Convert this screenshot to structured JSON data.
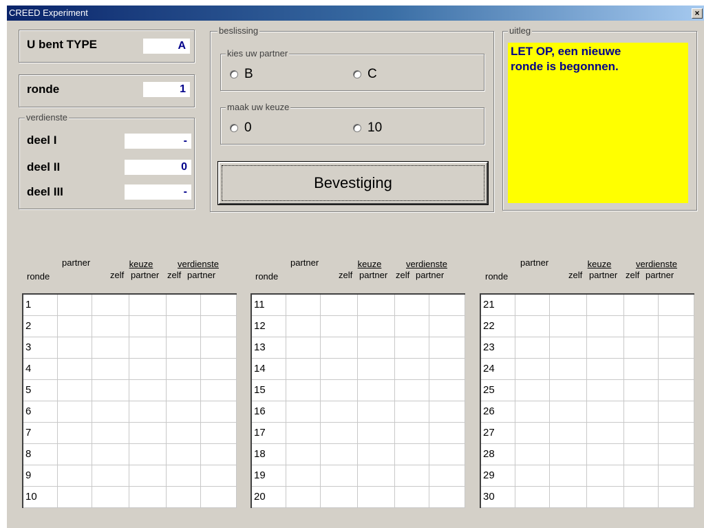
{
  "window": {
    "title": "CREED Experiment",
    "close_glyph": "×"
  },
  "type_panel": {
    "label": "U bent TYPE",
    "value": "A"
  },
  "round_panel": {
    "label": "ronde",
    "value": "1"
  },
  "earnings": {
    "legend": "verdienste",
    "rows": [
      {
        "label": "deel I",
        "value": "-"
      },
      {
        "label": "deel II",
        "value": "0"
      },
      {
        "label": "deel III",
        "value": "-"
      }
    ]
  },
  "decision": {
    "legend": "beslissing",
    "partner_group": {
      "legend": "kies uw partner",
      "options": [
        "B",
        "C"
      ]
    },
    "choice_group": {
      "legend": "maak uw keuze",
      "options": [
        "0",
        "10"
      ]
    },
    "confirm_label": "Bevestiging"
  },
  "explanation": {
    "legend": "uitleg",
    "message_line1": "LET OP, een nieuwe",
    "message_line2": "ronde is begonnen."
  },
  "table_headers": {
    "partner": "partner",
    "keuze": "keuze",
    "verdienste": "verdienste",
    "ronde": "ronde",
    "zelf": "zelf",
    "partner_sub": "partner"
  },
  "tables": [
    {
      "rounds": [
        "1",
        "2",
        "3",
        "4",
        "5",
        "6",
        "7",
        "8",
        "9",
        "10"
      ]
    },
    {
      "rounds": [
        "11",
        "12",
        "13",
        "14",
        "15",
        "16",
        "17",
        "18",
        "19",
        "20"
      ]
    },
    {
      "rounds": [
        "21",
        "22",
        "23",
        "24",
        "25",
        "26",
        "27",
        "28",
        "29",
        "30"
      ]
    }
  ],
  "colors": {
    "titlebar_start": "#0a246a",
    "panel_bg": "#d4d0c8",
    "message_bg": "#ffff00",
    "value_text": "#00008b"
  }
}
